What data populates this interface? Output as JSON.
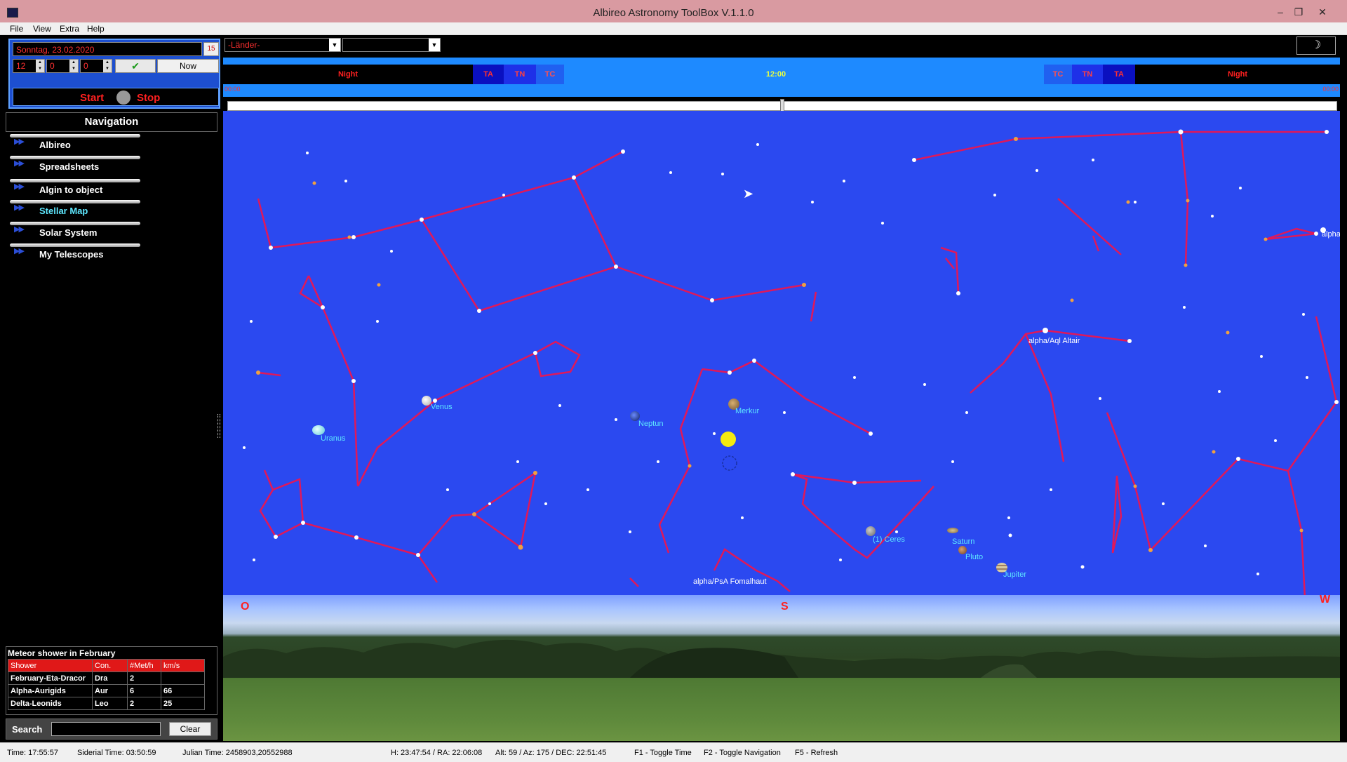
{
  "window": {
    "title": "Albireo Astronomy ToolBox V.1.1.0",
    "controls": [
      "–",
      "❐",
      "✕"
    ]
  },
  "menu": {
    "items": [
      "File",
      "View",
      "Extra",
      "Help"
    ]
  },
  "datetime": {
    "date": "Sonntag, 23.02.2020",
    "calendar_icon": "15",
    "hour": "12",
    "minute": "0",
    "second": "0",
    "ok_icon": "✔",
    "now_label": "Now",
    "start_label": "Start",
    "stop_label": "Stop"
  },
  "navigation": {
    "heading": "Navigation",
    "items": [
      {
        "label": "Albireo"
      },
      {
        "label": "Spreadsheets"
      },
      {
        "label": "Algin to object"
      },
      {
        "label": "Stellar Map"
      },
      {
        "label": "Solar System"
      },
      {
        "label": "My Telescopes"
      }
    ],
    "active": "Stellar Map"
  },
  "meteor": {
    "caption": "Meteor shower in February",
    "columns": [
      "Shower",
      "Con.",
      "#Met/h",
      "km/s"
    ],
    "rows": [
      [
        "February-Eta-Dracor",
        "Dra",
        "2",
        ""
      ],
      [
        "Alpha-Aurigids",
        "Aur",
        "6",
        "66"
      ],
      [
        "Delta-Leonids",
        "Leo",
        "2",
        "25"
      ]
    ]
  },
  "search": {
    "label": "Search",
    "value": "",
    "clear_label": "Clear"
  },
  "toolbar": {
    "country": "-Länder-",
    "city": "",
    "moon_icon": "☽"
  },
  "twilight": {
    "night_left": "Night",
    "ta": "TA",
    "tn": "TN",
    "tc": "TC",
    "noon": "12:00",
    "night_right": "Night",
    "hour_left": "00:00",
    "hour_right": "00:00"
  },
  "sky": {
    "cardinals": {
      "east": "O",
      "south": "S",
      "west": "W"
    },
    "planets": [
      "Venus",
      "Uranus",
      "Neptun",
      "Merkur",
      "(1) Ceres",
      "Saturn",
      "Pluto",
      "Jupiter"
    ],
    "stars": [
      "alpha/Aql Altair",
      "alpha/PsA Fomalhaut",
      "alpha/L"
    ],
    "colors": {
      "sky": "#2b49f0",
      "constellation_lines": "#e0185a",
      "labels": "#5ee8ff"
    }
  },
  "status": {
    "time": "Time: 17:55:57",
    "sidereal": "Siderial Time: 03:50:59",
    "julian": "Julian Time: 2458903,20552988",
    "hour_ra": "H: 23:47:54 / RA: 22:06:08",
    "alt_az": "Alt: 59 / Az: 175 / DEC: 22:51:45",
    "f1": "F1 - Toggle Time",
    "f2": "F2 - Toggle Navigation",
    "f5": "F5 - Refresh"
  }
}
